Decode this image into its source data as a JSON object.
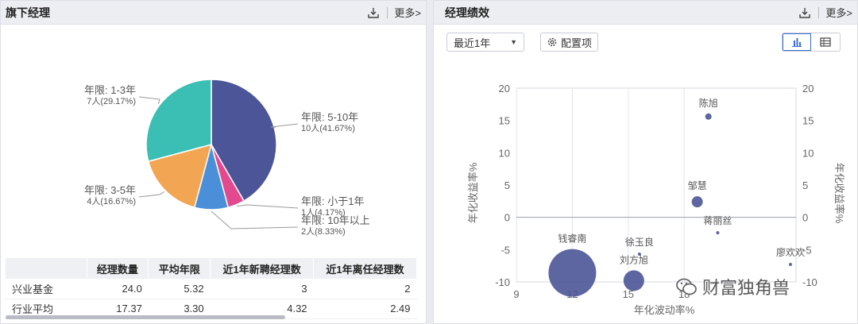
{
  "left": {
    "title": "旗下经理",
    "more_label": "更多>",
    "download_icon": "download-icon",
    "pie": {
      "type": "pie",
      "slices": [
        {
          "label": "年限: 5-10年",
          "detail": "10人(41.67%)",
          "count": 10,
          "percent": 41.67,
          "color": "#4b5597"
        },
        {
          "label": "年限: 小于1年",
          "detail": "1人(4.17%)",
          "count": 1,
          "percent": 4.17,
          "color": "#e3498e"
        },
        {
          "label": "年限: 10年以上",
          "detail": "2人(8.33%)",
          "count": 2,
          "percent": 8.33,
          "color": "#4a8fd8"
        },
        {
          "label": "年限: 3-5年",
          "detail": "4人(16.67%)",
          "count": 4,
          "percent": 16.67,
          "color": "#f2a552"
        },
        {
          "label": "年限: 1-3年",
          "detail": "7人(29.17%)",
          "count": 7,
          "percent": 29.17,
          "color": "#3bbfb4"
        }
      ]
    },
    "table": {
      "headers": [
        "",
        "经理数量",
        "平均年限",
        "近1年新聘经理数",
        "近1年离任经理数"
      ],
      "rows": [
        [
          "兴业基金",
          "24.0",
          "5.32",
          "3",
          "2"
        ],
        [
          "行业平均",
          "17.37",
          "3.30",
          "4.32",
          "2.49"
        ]
      ]
    }
  },
  "right": {
    "title": "经理绩效",
    "more_label": "更多>",
    "download_icon": "download-icon",
    "period_select": "最近1年",
    "config_label": "配置项",
    "config_icon": "gear-icon",
    "view_chart_icon": "bar-chart-icon",
    "view_table_icon": "table-icon",
    "chart_data": {
      "type": "scatter",
      "xlabel": "年化波动率%",
      "ylabel": "年化收益率%",
      "ylabel_right": "年化收益率%",
      "xlim": [
        9,
        24
      ],
      "ylim": [
        -10,
        20
      ],
      "x_ticks": [
        9,
        12,
        15,
        18
      ],
      "y_ticks": [
        20,
        15,
        10,
        5,
        0,
        -5,
        -10
      ],
      "points": [
        {
          "name": "陈旭",
          "x": 19.3,
          "y": 15.6,
          "size": 4
        },
        {
          "name": "邹慧",
          "x": 18.7,
          "y": 2.4,
          "size": 7
        },
        {
          "name": "蒋丽丝",
          "x": 19.8,
          "y": -2.4,
          "size": 2
        },
        {
          "name": "徐玉良",
          "x": 15.6,
          "y": -5.7,
          "size": 2
        },
        {
          "name": "刘方旭",
          "x": 15.3,
          "y": -9.8,
          "size": 13
        },
        {
          "name": "钱睿南",
          "x": 12.0,
          "y": -8.6,
          "size": 30
        },
        {
          "name": "廖欢欢",
          "x": 23.7,
          "y": -7.3,
          "size": 2
        }
      ],
      "point_color": "#4b5597"
    },
    "watermark": "财富独角兽"
  }
}
